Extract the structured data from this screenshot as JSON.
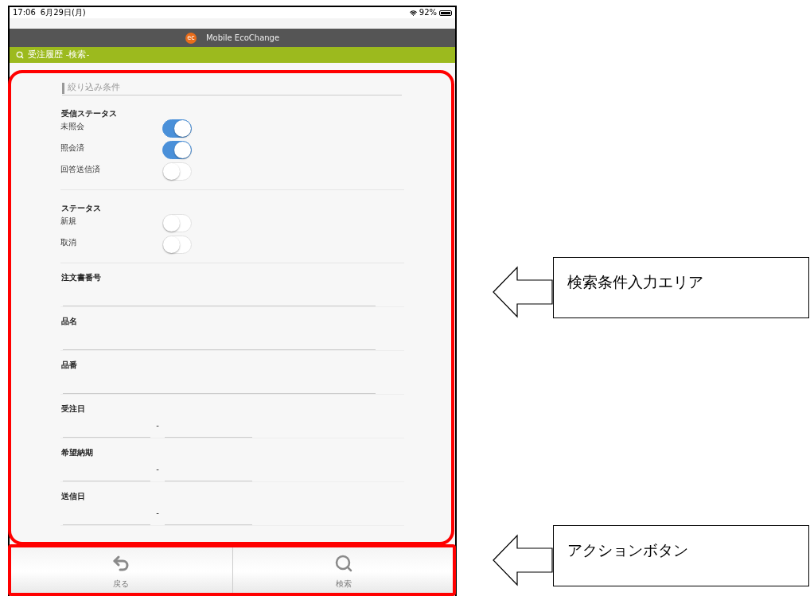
{
  "status_bar": {
    "time": "17:06",
    "date": "6月29日(月)",
    "battery": "92%"
  },
  "header": {
    "logo": "ec",
    "title": "Mobile EcoChange"
  },
  "page_title": "受注履歴 -検索-",
  "section_title": "絞り込み条件",
  "groups": [
    {
      "title": "受信ステータス",
      "toggles": [
        {
          "label": "未照会",
          "on": true
        },
        {
          "label": "照会済",
          "on": true
        },
        {
          "label": "回答送信済",
          "on": false
        }
      ]
    },
    {
      "title": "ステータス",
      "toggles": [
        {
          "label": "新規",
          "on": false
        },
        {
          "label": "取消",
          "on": false
        }
      ]
    }
  ],
  "fields": [
    {
      "kind": "text",
      "label": "注文書番号"
    },
    {
      "kind": "text",
      "label": "品名"
    },
    {
      "kind": "text",
      "label": "品番"
    },
    {
      "kind": "range",
      "label": "受注日",
      "separator": "-"
    },
    {
      "kind": "range",
      "label": "希望納期",
      "separator": "-"
    },
    {
      "kind": "range",
      "label": "送信日",
      "separator": "-"
    }
  ],
  "actions": [
    {
      "kind": "back",
      "label": "戻る"
    },
    {
      "kind": "search",
      "label": "検索"
    }
  ],
  "callouts": [
    {
      "text": "検索条件入力エリア"
    },
    {
      "text": "アクションボタン"
    }
  ]
}
